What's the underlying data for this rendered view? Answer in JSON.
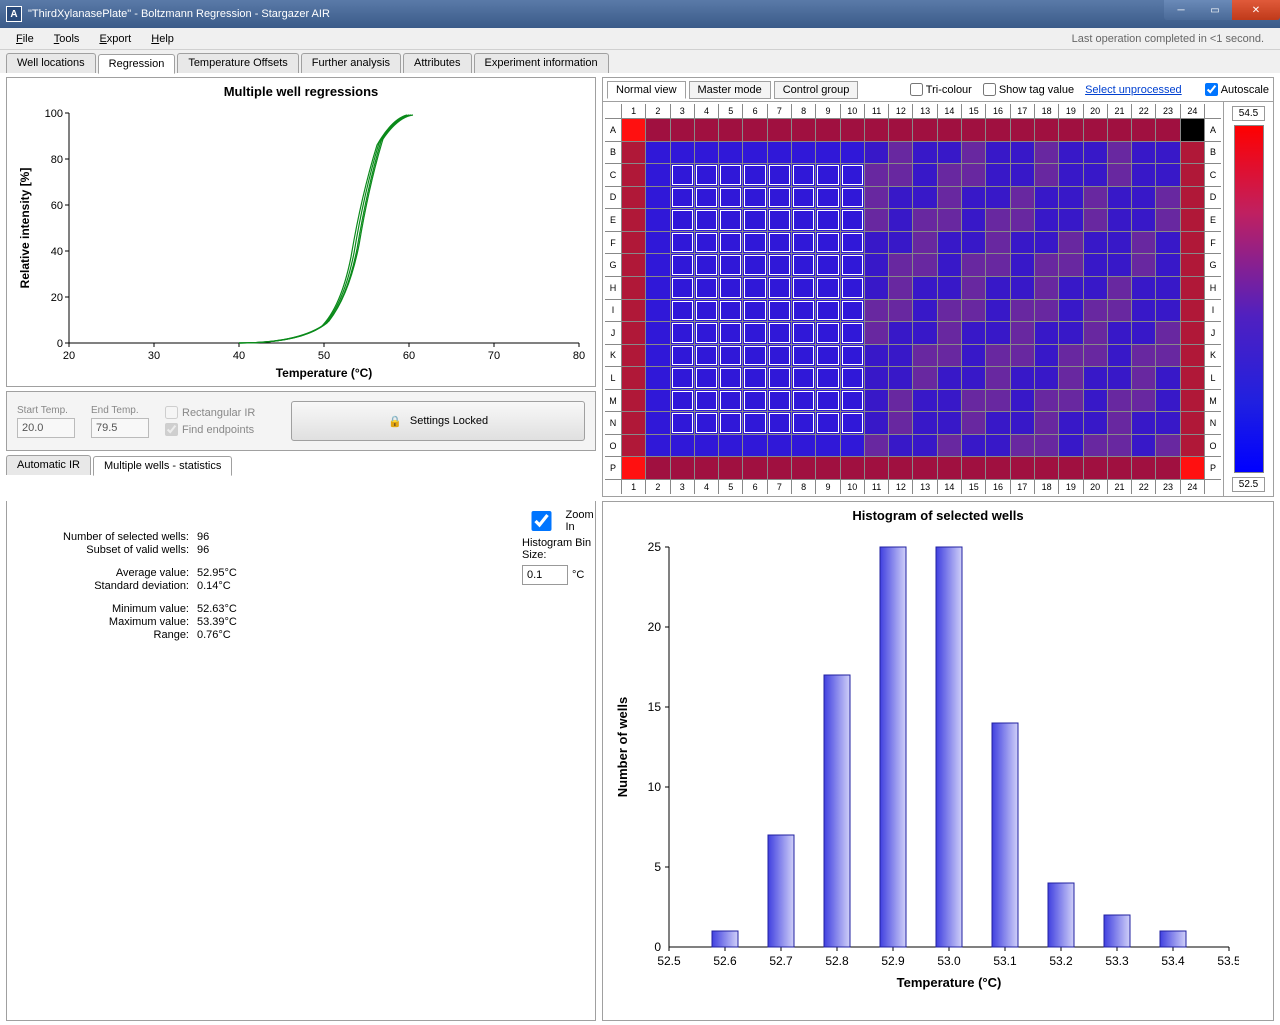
{
  "window": {
    "title": "\"ThirdXylanasePlate\" - Boltzmann Regression - Stargazer AIR",
    "app_icon_letter": "A"
  },
  "menubar": {
    "items": [
      "File",
      "Tools",
      "Export",
      "Help"
    ],
    "status": "Last operation completed in <1 second."
  },
  "tabs_main": [
    "Well locations",
    "Regression",
    "Temperature Offsets",
    "Further analysis",
    "Attributes",
    "Experiment information"
  ],
  "tabs_main_active": 1,
  "regression_chart": {
    "title": "Multiple well regressions",
    "xlabel": "Temperature (°C)",
    "ylabel": "Relative intensity [%]"
  },
  "controls": {
    "start_label": "Start Temp.",
    "start_value": "20.0",
    "end_label": "End Temp.",
    "end_value": "79.5",
    "rect_ir": "Rectangular IR",
    "find_endpoints": "Find endpoints",
    "settings_locked": "Settings Locked"
  },
  "tabs_secondary": [
    "Automatic IR",
    "Multiple wells - statistics"
  ],
  "tabs_secondary_active": 1,
  "plate_toolbar": {
    "buttons": [
      "Normal view",
      "Master mode",
      "Control group"
    ],
    "tri_colour": "Tri-colour",
    "show_tag": "Show tag value",
    "select_unprocessed": "Select unprocessed",
    "autoscale": "Autoscale"
  },
  "plate": {
    "cols": [
      "1",
      "2",
      "3",
      "4",
      "5",
      "6",
      "7",
      "8",
      "9",
      "10",
      "11",
      "12",
      "13",
      "14",
      "15",
      "16",
      "17",
      "18",
      "19",
      "20",
      "21",
      "22",
      "23",
      "24"
    ],
    "rows": [
      "A",
      "B",
      "C",
      "D",
      "E",
      "F",
      "G",
      "H",
      "I",
      "J",
      "K",
      "L",
      "M",
      "N",
      "O",
      "P"
    ]
  },
  "colorbar": {
    "max": "54.5",
    "min": "52.5"
  },
  "stats": {
    "selected_label": "Number of selected wells:",
    "selected_val": "96",
    "valid_label": "Subset of valid wells:",
    "valid_val": "96",
    "avg_label": "Average value:",
    "avg_val": "52.95°C",
    "std_label": "Standard deviation:",
    "std_val": "0.14°C",
    "min_label": "Minimum value:",
    "min_val": "52.63°C",
    "max_label": "Maximum value:",
    "max_val": "53.39°C",
    "range_label": "Range:",
    "range_val": "0.76°C",
    "zoom_in": "Zoom In",
    "bin_label": "Histogram Bin Size:",
    "bin_val": "0.1",
    "bin_unit": "°C"
  },
  "histogram": {
    "title": "Histogram of selected wells",
    "xlabel": "Temperature (°C)",
    "ylabel": "Number of wells"
  },
  "chart_data": [
    {
      "type": "line",
      "title": "Multiple well regressions",
      "xlabel": "Temperature (°C)",
      "ylabel": "Relative intensity [%]",
      "xlim": [
        20,
        80
      ],
      "ylim": [
        0,
        100
      ],
      "series": [
        {
          "name": "wells",
          "x": [
            40,
            42,
            44,
            46,
            48,
            50,
            51,
            52,
            53,
            54,
            55,
            56,
            57,
            58,
            59,
            60
          ],
          "values": [
            0,
            0.5,
            1,
            2,
            4,
            8,
            14,
            25,
            45,
            70,
            85,
            93,
            97,
            99,
            100,
            100
          ]
        }
      ]
    },
    {
      "type": "bar",
      "title": "Histogram of selected wells",
      "xlabel": "Temperature (°C)",
      "ylabel": "Number of wells",
      "categories": [
        "52.6",
        "52.7",
        "52.8",
        "52.9",
        "53.0",
        "53.1",
        "53.2",
        "53.3",
        "53.4"
      ],
      "values": [
        1,
        7,
        17,
        25,
        25,
        14,
        4,
        2,
        1
      ],
      "xlim": [
        52.5,
        53.5
      ],
      "ylim": [
        0,
        25
      ]
    }
  ]
}
